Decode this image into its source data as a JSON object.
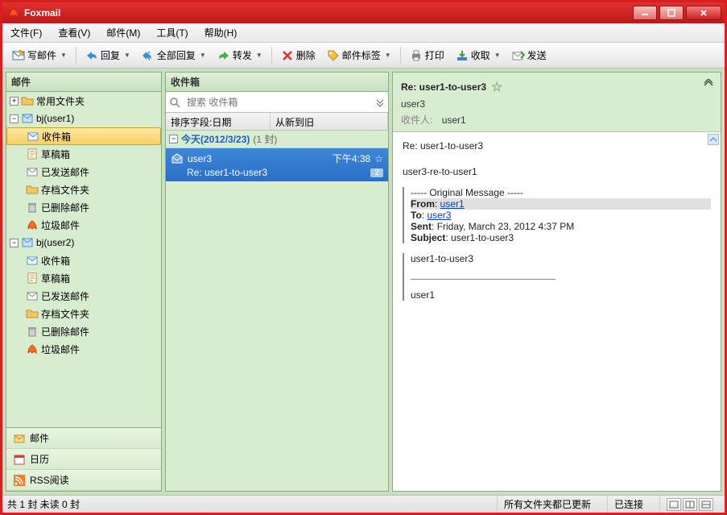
{
  "app_title": "Foxmail",
  "menus": {
    "file": "文件(F)",
    "view": "查看(V)",
    "mail": "邮件(M)",
    "tools": "工具(T)",
    "help": "帮助(H)"
  },
  "toolbar": {
    "compose": "写邮件",
    "reply": "回复",
    "reply_all": "全部回复",
    "forward": "转发",
    "delete": "删除",
    "tags": "邮件标签",
    "print": "打印",
    "receive": "收取",
    "send": "发送"
  },
  "sidebar": {
    "header": "邮件",
    "common_folders": "常用文件夹",
    "accounts": [
      {
        "name": "bj(user1)",
        "folders": {
          "inbox": "收件箱",
          "drafts": "草稿箱",
          "sent": "已发送邮件",
          "archive": "存档文件夹",
          "trash": "已删除邮件",
          "spam": "垃圾邮件"
        }
      },
      {
        "name": "bj(user2)",
        "folders": {
          "inbox": "收件箱",
          "drafts": "草稿箱",
          "sent": "已发送邮件",
          "archive": "存档文件夹",
          "trash": "已删除邮件",
          "spam": "垃圾邮件"
        }
      }
    ],
    "nav": {
      "mail": "邮件",
      "calendar": "日历",
      "rss": "RSS阅读"
    }
  },
  "maillist": {
    "header": "收件箱",
    "search_placeholder": "搜索 收件箱",
    "sort_label": "排序字段:日期",
    "sort_order": "从新到旧",
    "group": {
      "label": "今天(2012/3/23)",
      "count": "(1 封)"
    },
    "items": [
      {
        "sender": "user3",
        "time": "下午4:38",
        "subject": "Re: user1-to-user3",
        "badge": "2"
      }
    ]
  },
  "preview": {
    "subject": "Re: user1-to-user3",
    "from": "user3",
    "recipient_label": "收件人:",
    "recipient": "user1",
    "body_line1": "Re: user1-to-user3",
    "body_line2": "user3-re-to-user1",
    "original": {
      "header": "----- Original Message -----",
      "from_label": "From",
      "from": "user1",
      "to_label": "To",
      "to": "user3",
      "sent_label": "Sent",
      "sent": "Friday, March 23, 2012 4:37 PM",
      "subject_label": "Subject",
      "subject": "user1-to-user3"
    },
    "quoted_line1": "user1-to-user3",
    "quoted_line2": "user1"
  },
  "statusbar": {
    "count": "共 1 封 未读 0 封",
    "sync": "所有文件夹都已更新",
    "connection": "已连接"
  }
}
